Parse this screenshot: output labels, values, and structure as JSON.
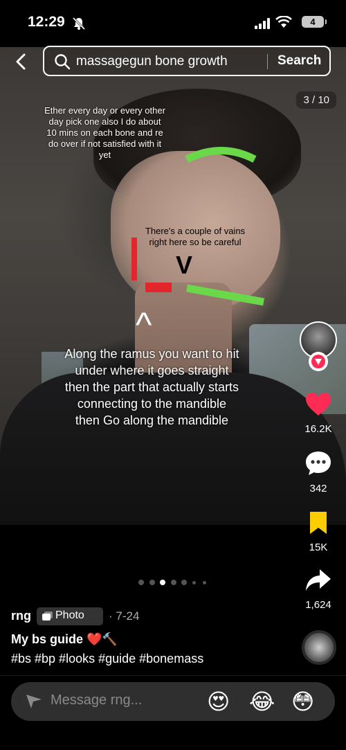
{
  "status_bar": {
    "time": "12:29",
    "battery": "4"
  },
  "search": {
    "query": "massagegun bone growth",
    "button": "Search"
  },
  "counter": "3 / 10",
  "overlay_text": {
    "top": "Ether every day or every other day pick one also I do about 10 mins on each bone and re do over if not satisfied with it yet",
    "middle": "There's a couple of vains right here so be careful",
    "v_symbol": "V",
    "caret_symbol": "^",
    "bottom": "Along the ramus you want to hit under where it goes straight then the part that actually starts connecting to the mandible then Go along the mandible"
  },
  "colors": {
    "green_mark": "#6bd84a",
    "red_mark": "#e2262b",
    "like_red": "#fe2c55",
    "save_yellow": "#facd00"
  },
  "actions": {
    "likes": "16.2K",
    "comments": "342",
    "saves": "15K",
    "shares": "1,624"
  },
  "carousel": {
    "count": 7,
    "active_index": 2
  },
  "post": {
    "username": "rng",
    "badge": "Photo",
    "date": "· 7-24",
    "title": "My bs guide ❤️🔨",
    "tags": "#bs #bp #looks #guide #bonemass"
  },
  "message_bar": {
    "placeholder": "Message rng...",
    "emojis": [
      "😍",
      "😂",
      "😳"
    ]
  },
  "icons": [
    "back-arrow-icon",
    "search-icon",
    "heart-icon",
    "comment-icon",
    "bookmark-icon",
    "share-icon",
    "send-icon",
    "photo-icon",
    "follow-plus-icon"
  ]
}
